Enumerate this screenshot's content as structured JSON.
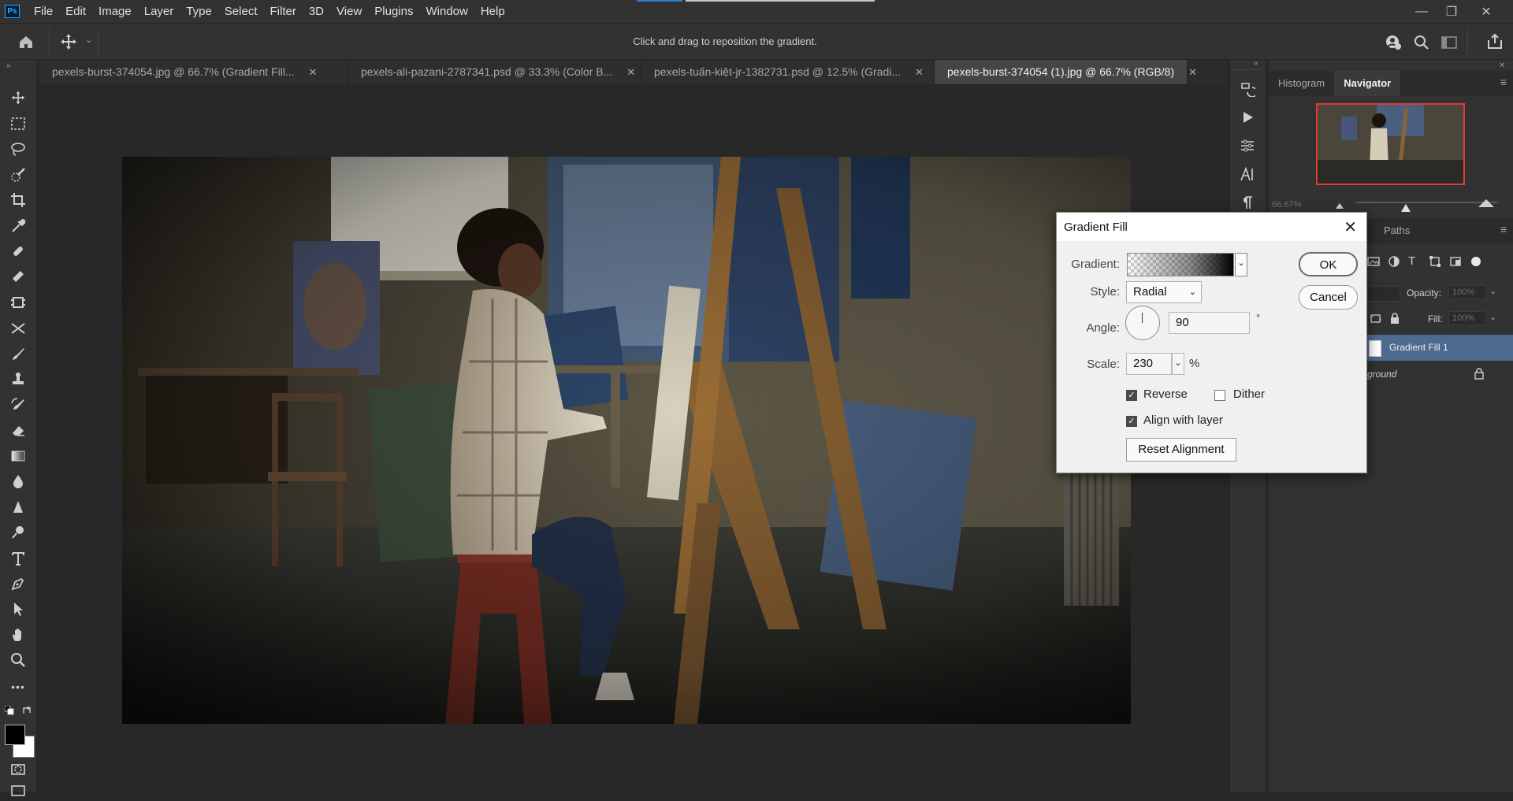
{
  "app": {
    "logo": "Ps"
  },
  "menu": [
    "File",
    "Edit",
    "Image",
    "Layer",
    "Type",
    "Select",
    "Filter",
    "3D",
    "View",
    "Plugins",
    "Window",
    "Help"
  ],
  "window_controls": {
    "minimize": "—",
    "restore": "❐",
    "close": "✕"
  },
  "options_bar": {
    "message": "Click and drag to reposition the gradient."
  },
  "tabs": [
    {
      "label": "pexels-burst-374054.jpg @ 66.7% (Gradient Fill...",
      "close": "✕"
    },
    {
      "label": "pexels-ali-pazani-2787341.psd @ 33.3% (Color B...",
      "close": "✕"
    },
    {
      "label": "pexels-tuấn-kiệt-jr-1382731.psd @ 12.5% (Gradi...",
      "close": "✕"
    },
    {
      "label": "pexels-burst-374054 (1).jpg @ 66.7% (RGB/8)",
      "close": "✕"
    }
  ],
  "toolbar": {
    "tools": [
      "move-icon",
      "marquee-icon",
      "lasso-icon",
      "quick-select-icon",
      "crop-icon",
      "eyedropper-icon",
      "healing-icon",
      "brush-icon",
      "stamp-icon",
      "history-brush-icon",
      "eraser-icon",
      "gradient-icon",
      "blur-icon",
      "dodge-icon",
      "pen-icon",
      "type-icon",
      "path-select-icon",
      "hand-icon",
      "zoom-icon",
      "more-icon"
    ],
    "more": "•••"
  },
  "panels": {
    "navigator_tabs": [
      "Histogram",
      "Navigator"
    ],
    "zoom_value": "66.67%",
    "layers_tabs": [
      "Paths"
    ],
    "opacity_label": "Opacity:",
    "opacity_value": "100%",
    "fill_label": "Fill:",
    "fill_value": "100%",
    "layers": [
      {
        "name": "Gradient Fill 1"
      },
      {
        "name": "ground"
      }
    ]
  },
  "dialog": {
    "title": "Gradient Fill",
    "close": "✕",
    "gradient_label": "Gradient:",
    "style_label": "Style:",
    "style_value": "Radial",
    "angle_label": "Angle:",
    "angle_value": "90",
    "angle_unit": "°",
    "scale_label": "Scale:",
    "scale_value": "230",
    "scale_unit": "%",
    "reverse_label": "Reverse",
    "reverse_checked": true,
    "dither_label": "Dither",
    "dither_checked": false,
    "align_label": "Align with layer",
    "align_checked": true,
    "reset_label": "Reset Alignment",
    "ok_label": "OK",
    "cancel_label": "Cancel"
  },
  "colors": {
    "accent": "#31a8ff",
    "bg": "#282828",
    "panel": "#323232",
    "highlight_layer": "#4d6a8f",
    "navigator_frame": "#e03a3a"
  }
}
